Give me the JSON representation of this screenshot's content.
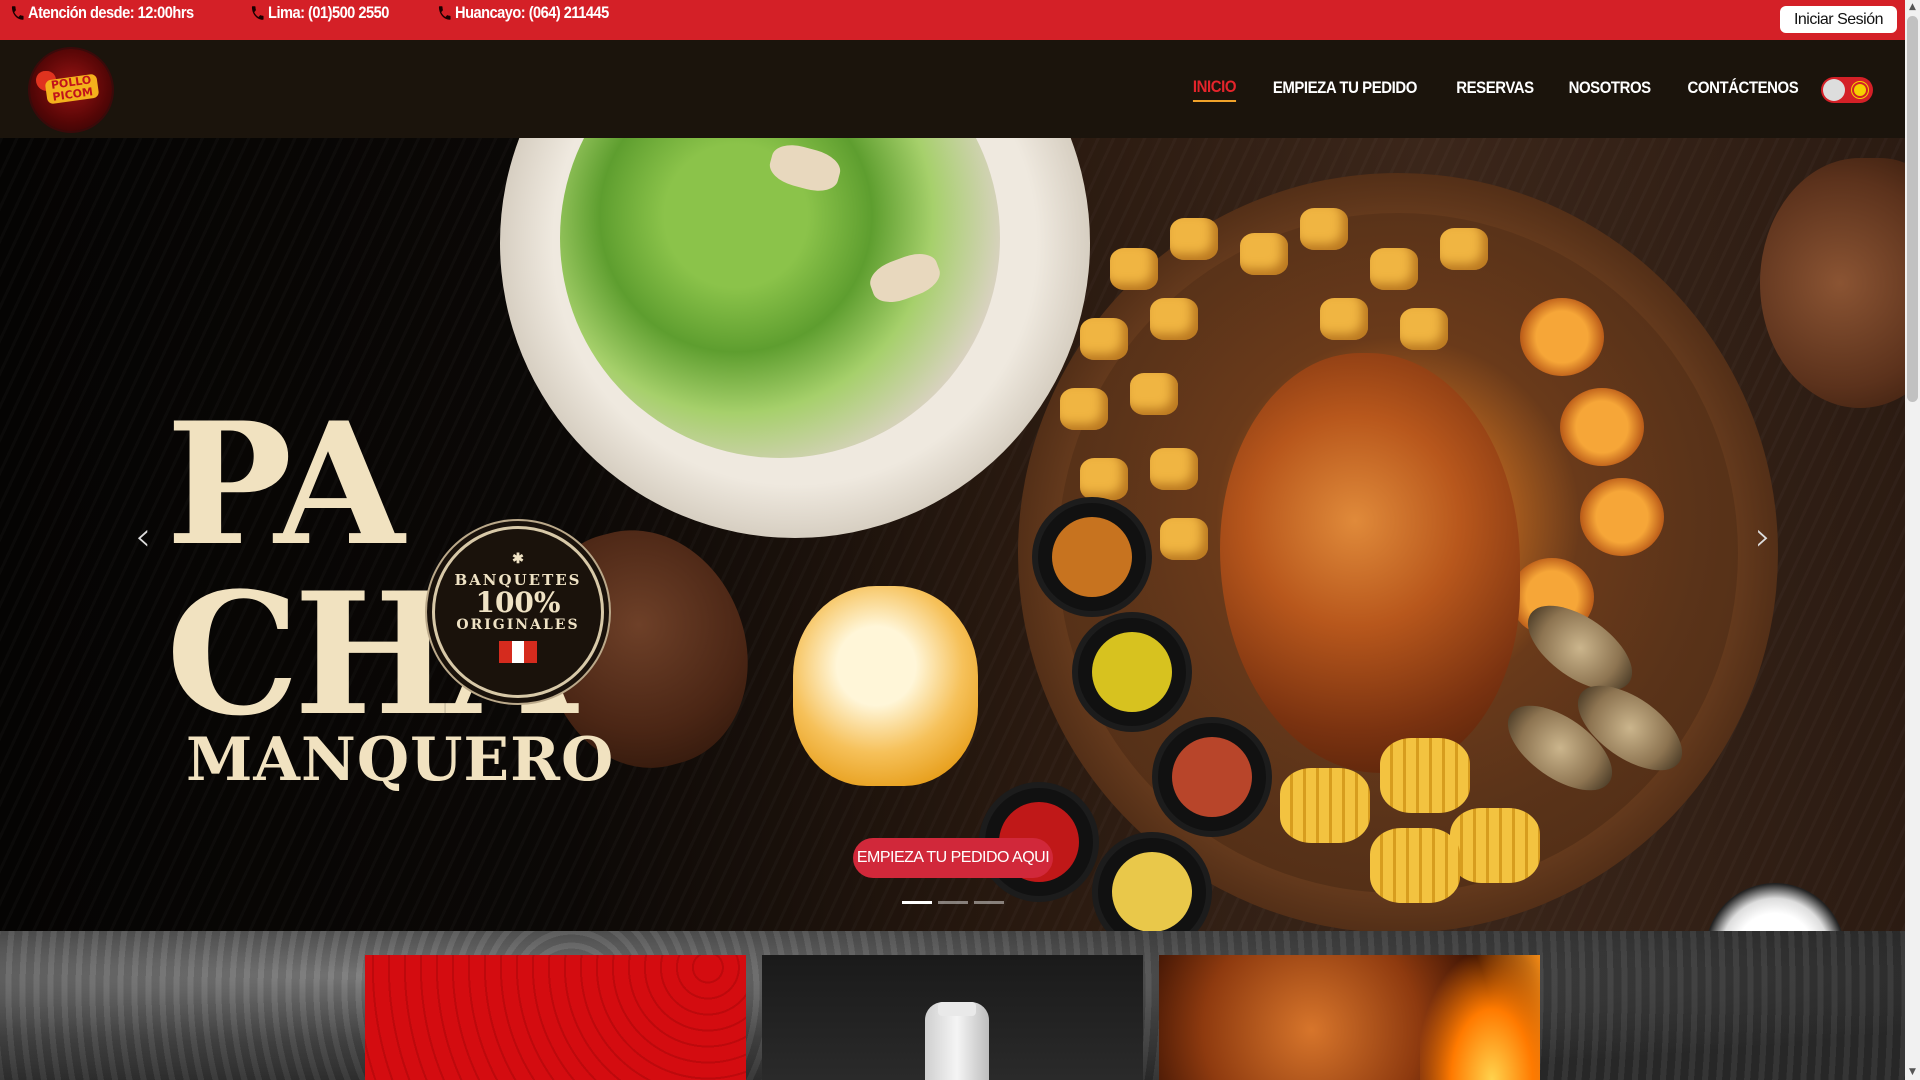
{
  "topbar": {
    "hours": "Atención desde: 12:00hrs",
    "lima": "Lima: (01)500 2550",
    "huancayo": "Huancayo: (064) 211445",
    "login_label": "Iniciar Sesión"
  },
  "brand": {
    "logo_text": "POLLO PICOM"
  },
  "nav": {
    "items": [
      {
        "label": "INICIO",
        "active": true
      },
      {
        "label": "EMPIEZA TU PEDIDO",
        "active": false
      },
      {
        "label": "RESERVAS",
        "active": false
      },
      {
        "label": "NOSOTROS",
        "active": false
      },
      {
        "label": "CONTÁCTENOS",
        "active": false
      }
    ],
    "theme_toggle": "sun-icon"
  },
  "hero": {
    "title_line1": "PA",
    "title_line2": "CHA",
    "title_line3": "MANQUERO",
    "seal_line1": "BANQUETES",
    "seal_line2": "100%",
    "seal_line3": "ORIGINALES",
    "prev_icon": "‹",
    "next_icon": "›",
    "cta_label": "EMPIEZA TU PEDIDO AQUI",
    "slides_total": 3,
    "slide_active": 1
  },
  "colors": {
    "brand_red": "#d42027",
    "nav_bg": "#1b140c",
    "active_link": "#e5242b",
    "cta": "#d1283a",
    "title_cream": "#f1e2c0"
  }
}
